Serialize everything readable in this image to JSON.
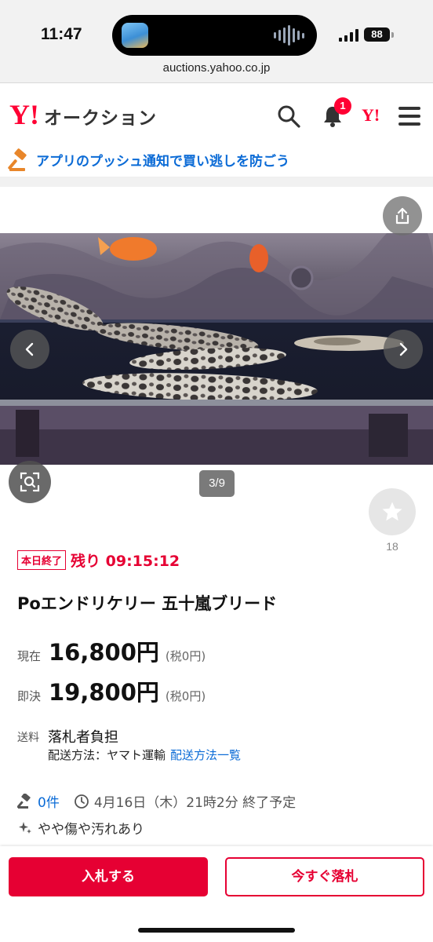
{
  "status_bar": {
    "time": "11:47",
    "battery": "88"
  },
  "browser": {
    "url": "auctions.yahoo.co.jp"
  },
  "header": {
    "logo_mark": "Y!",
    "logo_text": "オークション",
    "notification_count": "1",
    "yahoo_mark": "Y!",
    "icons": [
      "search-icon",
      "bell-icon",
      "yahoo-logo",
      "menu-icon"
    ]
  },
  "push_banner": {
    "text": "アプリのプッシュ通知で買い逃しを防ごう",
    "icon": "auction-hammer-icon"
  },
  "gallery": {
    "counter": "3/9",
    "watch_count": "18",
    "icons": [
      "share-icon",
      "chevron-left-icon",
      "chevron-right-icon",
      "image-search-icon",
      "star-icon"
    ]
  },
  "item": {
    "end_badge": "本日終了",
    "remaining": "残り 09:15:12",
    "title": "Poエンドリケリー 五十嵐ブリード",
    "current_label": "現在",
    "current_price": "16,800円",
    "current_tax": "(税0円)",
    "buynow_label": "即決",
    "buynow_price": "19,800円",
    "buynow_tax": "(税0円)",
    "shipping_label": "送料",
    "shipping_value": "落札者負担",
    "shipping_method": "配送方法：ヤマト運輸",
    "shipping_link": "配送方法一覧",
    "bids": "0件",
    "end_time": "4月16日（木）21時2分 終了予定",
    "condition": "やや傷や汚れあり"
  },
  "actions": {
    "bid": "入札する",
    "buy_now": "今すぐ落札"
  },
  "colors": {
    "brand_red": "#e60033",
    "link_blue": "#0b6bd6"
  }
}
